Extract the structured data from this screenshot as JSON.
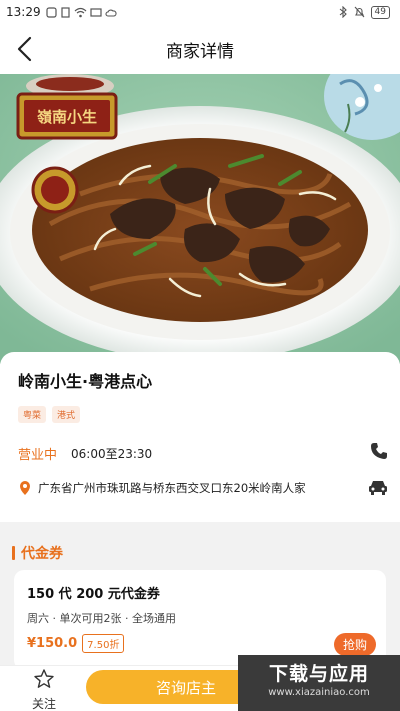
{
  "status_bar": {
    "time": "13:29",
    "battery": "49"
  },
  "nav": {
    "title": "商家详情"
  },
  "hero": {
    "logo_text": "嶺南小生"
  },
  "shop": {
    "name": "岭南小生·粤港点心",
    "tags": [
      "粤菜",
      "港式"
    ],
    "open_status": "营业中",
    "hours": "06:00至23:30",
    "address": "广东省广州市珠玑路与桥东西交叉口东20米岭南人家"
  },
  "voucher_section": {
    "title": "代金券"
  },
  "voucher": {
    "title": "150 代 200 元代金券",
    "desc": "周六 · 单次可用2张 · 全场通用",
    "price": "¥150.0",
    "discount": "7.50折",
    "buy_label": "抢购"
  },
  "bottom": {
    "follow_label": "关注",
    "consult_label": "咨询店主"
  },
  "watermark": {
    "main": "下载与应用",
    "url": "www.xiazainiao.com"
  },
  "colors": {
    "accent": "#e8711e",
    "consult": "#f7b229",
    "hero_bg": "#8fc3a3"
  }
}
